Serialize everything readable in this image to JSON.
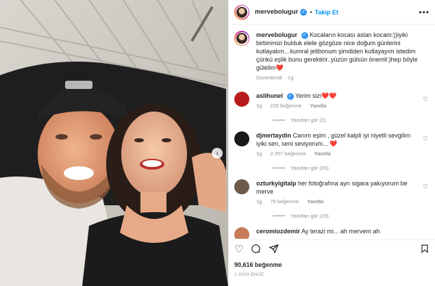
{
  "post": {
    "username": "mervebolugur",
    "follow_label": "Takip Et",
    "more_label": "•••",
    "next_label": "›",
    "caption_user": "mervebolugur",
    "caption_text": "Kocaların kocası aslan kocam:))iyiki birbirimizi bulduk elele gözgöze nice doğum günlerini kutlayalım…kumral jelibonum şimdiden kutlayayım istedim çünkü eşlik bunu gerektirir..yüzün gülsün önemli:)hep böyle gülelim",
    "caption_heart": "❤️",
    "caption_meta_edited": "Düzenlendi",
    "caption_meta_time": "1g"
  },
  "comments": [
    {
      "user": "aslihunel",
      "verified": true,
      "text": "Yerim sizi❤️❤️",
      "time": "1g",
      "likes": "228 beğenme",
      "reply": "Yanıtla",
      "replies": "Yanıtları gör (2)",
      "avatar_color": "#b71c1c"
    },
    {
      "user": "djmertaydin",
      "verified": false,
      "text": "Canım eşim , güzel kalpli iyi niyetli sevgilim iyiki sen, seni seviyorum...",
      "heart": "❤️",
      "time": "1g",
      "likes": "2.057 beğenme",
      "reply": "Yanıtla",
      "replies": "Yanıtları gör (26)",
      "avatar_color": "#1a1a1a"
    },
    {
      "user": "ozturkyigitalp",
      "verified": false,
      "text": "her fotoğrafına ayrı sigara yakıyorum be merve",
      "time": "1g",
      "likes": "79 beğenme",
      "reply": "Yanıtla",
      "replies": "Yanıtları gör (19)",
      "avatar_color": "#6d5a4b"
    },
    {
      "user": "ceromiozdemir",
      "verified": false,
      "text": "Ay terazi mi... ah mervem ah",
      "avatar_color": "#c77b5a"
    }
  ],
  "footer": {
    "likes": "90,616 beğenme",
    "date": "1 GÜN ÖNCE"
  },
  "icons": {
    "like": "heart-icon",
    "comment": "comment-icon",
    "share": "share-icon",
    "save": "bookmark-icon",
    "next": "chevron-right-icon"
  },
  "colors": {
    "accent": "#0095f6",
    "verified": "#3897f0",
    "heart": "#ed4956",
    "muted": "#8e8e8e"
  }
}
